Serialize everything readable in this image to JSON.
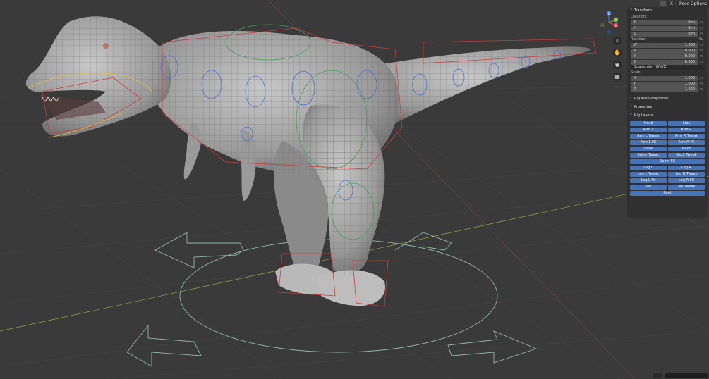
{
  "header": {
    "pose_options_label": "Pose Options",
    "close_label": "X"
  },
  "transform": {
    "title": "Transform",
    "location_label": "Location:",
    "location": [
      {
        "axis": "X",
        "value": "0 m"
      },
      {
        "axis": "Y",
        "value": "0 m"
      },
      {
        "axis": "Z",
        "value": "0 m"
      }
    ],
    "rotation_label": "Rotation:",
    "rotation_mode_tag": "4L",
    "rotation": [
      {
        "axis": "W",
        "value": "1.000"
      },
      {
        "axis": "X",
        "value": "0.000"
      },
      {
        "axis": "Y",
        "value": "0.000"
      },
      {
        "axis": "Z",
        "value": "0.000"
      }
    ],
    "rotation_mode": "Quaternion (WXYZ)",
    "scale_label": "Scale:",
    "scale": [
      {
        "axis": "X",
        "value": "1.000"
      },
      {
        "axis": "Y",
        "value": "1.000"
      },
      {
        "axis": "Z",
        "value": "1.000"
      }
    ]
  },
  "sections": {
    "rig_main": "Rig Main Properties",
    "properties": "Properties",
    "rig_layers": "Rig Layers"
  },
  "rig_layers": [
    {
      "label": "Head"
    },
    {
      "label": "Lips"
    },
    {
      "label": "Arm L"
    },
    {
      "label": "Arm R"
    },
    {
      "label": "Arm L Tweak"
    },
    {
      "label": "Arm R Tweak"
    },
    {
      "label": "Arm L FK"
    },
    {
      "label": "Arm R FK"
    },
    {
      "label": "Spine"
    },
    {
      "label": "Neck"
    },
    {
      "label": "Spine Tweak"
    },
    {
      "label": "Neck Tweak"
    },
    {
      "label": "Spine FK",
      "wide": true
    },
    {
      "label": "Leg L"
    },
    {
      "label": "Leg R"
    },
    {
      "label": "Leg L Tweak"
    },
    {
      "label": "Leg R Tweak"
    },
    {
      "label": "Leg L FK"
    },
    {
      "label": "Leg R FK"
    },
    {
      "label": "Tail"
    },
    {
      "label": "Tail Tweak"
    },
    {
      "label": "Root",
      "wide": true
    }
  ],
  "gizmo": {
    "axes": [
      "Z",
      "Y",
      "X"
    ]
  },
  "nav_tools": [
    "zoom-icon",
    "hand-icon",
    "camera-icon",
    "grid-icon"
  ],
  "colors": {
    "viewport_bg": "#3a3a3a",
    "panel_bg": "#303030",
    "button_blue": "#4772b3",
    "axis_x": "#e0424a",
    "axis_y": "#6fa84a",
    "axis_z": "#3f7ee0"
  }
}
